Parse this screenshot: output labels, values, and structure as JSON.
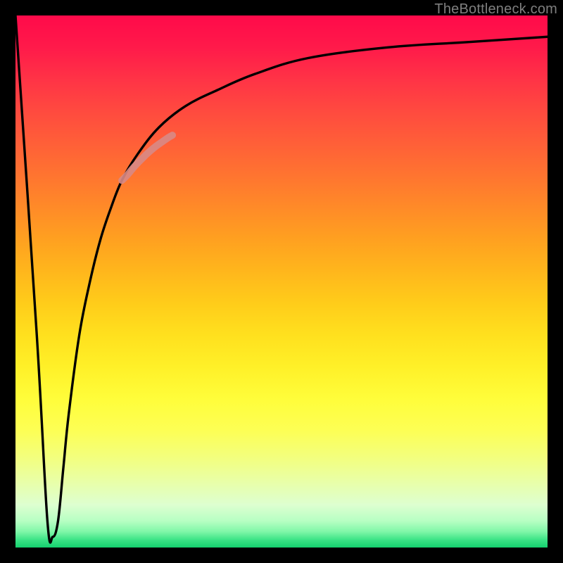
{
  "watermark": "TheBottleneck.com",
  "chart_data": {
    "type": "line",
    "title": "",
    "xlabel": "",
    "ylabel": "",
    "xlim": [
      0,
      100
    ],
    "ylim": [
      0,
      100
    ],
    "grid": false,
    "background": "vertical-gradient red→yellow→green",
    "series": [
      {
        "name": "bottleneck-curve",
        "color": "#000000",
        "x": [
          0,
          4,
          6,
          7,
          8,
          9,
          10,
          12,
          14,
          16,
          18,
          20,
          23,
          27,
          32,
          38,
          45,
          55,
          70,
          85,
          100
        ],
        "values": [
          100,
          40,
          5,
          2,
          5,
          15,
          25,
          40,
          50,
          58,
          64,
          69,
          74,
          79,
          83,
          86,
          89,
          92,
          94,
          95,
          96
        ]
      },
      {
        "name": "highlight-segment",
        "color": "#d88a86",
        "x": [
          20,
          21,
          22,
          23,
          24,
          24.5,
          25.5,
          26.5,
          27.5,
          28.5,
          29.5
        ],
        "values": [
          69,
          70,
          71.2,
          72.3,
          73.3,
          73.8,
          74.7,
          75.5,
          76.2,
          76.9,
          77.5
        ]
      }
    ],
    "annotations": []
  }
}
